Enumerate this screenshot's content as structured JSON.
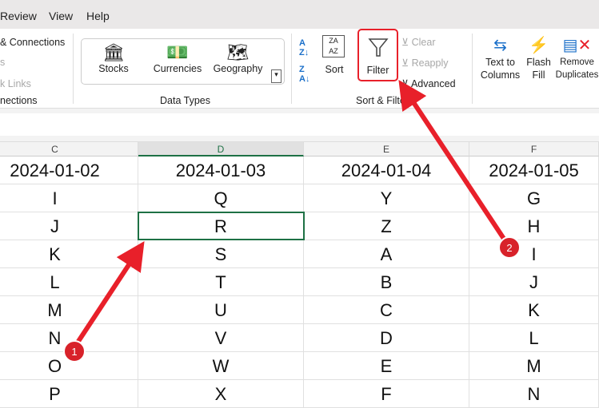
{
  "menu": [
    "Review",
    "View",
    "Help"
  ],
  "ribbon": {
    "queries": {
      "connections": "& Connections",
      "properties": "s",
      "edit_links": "k Links",
      "group": "nections"
    },
    "data_types": {
      "items": [
        "Stocks",
        "Currencies",
        "Geography"
      ],
      "group": "Data Types"
    },
    "sort_filter": {
      "sort": "Sort",
      "filter": "Filter",
      "clear": "Clear",
      "reapply": "Reapply",
      "advanced": "Advanced",
      "group": "Sort & Filter"
    },
    "tools": {
      "text_to_columns": [
        "Text to",
        "Columns"
      ],
      "flash_fill": [
        "Flash",
        "Fill"
      ],
      "remove_duplicates": [
        "Remove",
        "Duplicates"
      ]
    }
  },
  "columns": [
    {
      "letter": "C",
      "date": "2024-01-02",
      "values": [
        "I",
        "J",
        "K",
        "L",
        "M",
        "N",
        "O",
        "P"
      ]
    },
    {
      "letter": "D",
      "date": "2024-01-03",
      "values": [
        "Q",
        "R",
        "S",
        "T",
        "U",
        "V",
        "W",
        "X"
      ]
    },
    {
      "letter": "E",
      "date": "2024-01-04",
      "values": [
        "Y",
        "Z",
        "A",
        "B",
        "C",
        "D",
        "E",
        "F"
      ]
    },
    {
      "letter": "F",
      "date": "2024-01-05",
      "values": [
        "G",
        "H",
        "I",
        "J",
        "K",
        "L",
        "M",
        "N"
      ]
    }
  ],
  "annotations": [
    "1",
    "2"
  ],
  "colors": {
    "accent": "#1e7145",
    "annotation": "#e8202a"
  }
}
